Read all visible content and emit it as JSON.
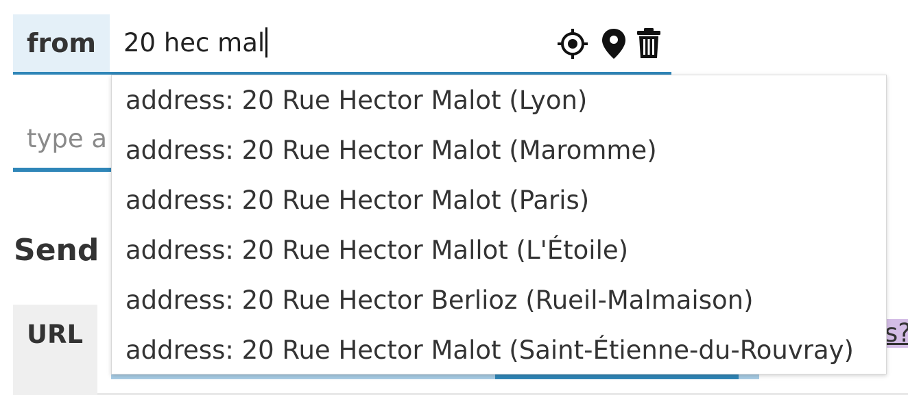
{
  "from": {
    "label": "from",
    "value": "20 hec mal",
    "icons": [
      "locate-icon",
      "map-pin-icon",
      "trash-icon"
    ]
  },
  "to": {
    "placeholder_visible": "type a"
  },
  "send_heading": "Send",
  "url": {
    "label": "URL",
    "visible_fragment": "s?"
  },
  "suggestions": [
    "address: 20 Rue Hector Malot (Lyon)",
    "address: 20 Rue Hector Malot (Maromme)",
    "address: 20 Rue Hector Malot (Paris)",
    "address: 20 Rue Hector Mallot (L'Étoile)",
    "address: 20 Rue Hector Berlioz (Rueil-Malmaison)",
    "address: 20 Rue Hector Malot (Saint-Étienne-du-Rouvray)"
  ],
  "colors": {
    "accent": "#2f86b8",
    "from_label_bg": "#e4f0f8",
    "url_label_bg": "#efefef"
  }
}
